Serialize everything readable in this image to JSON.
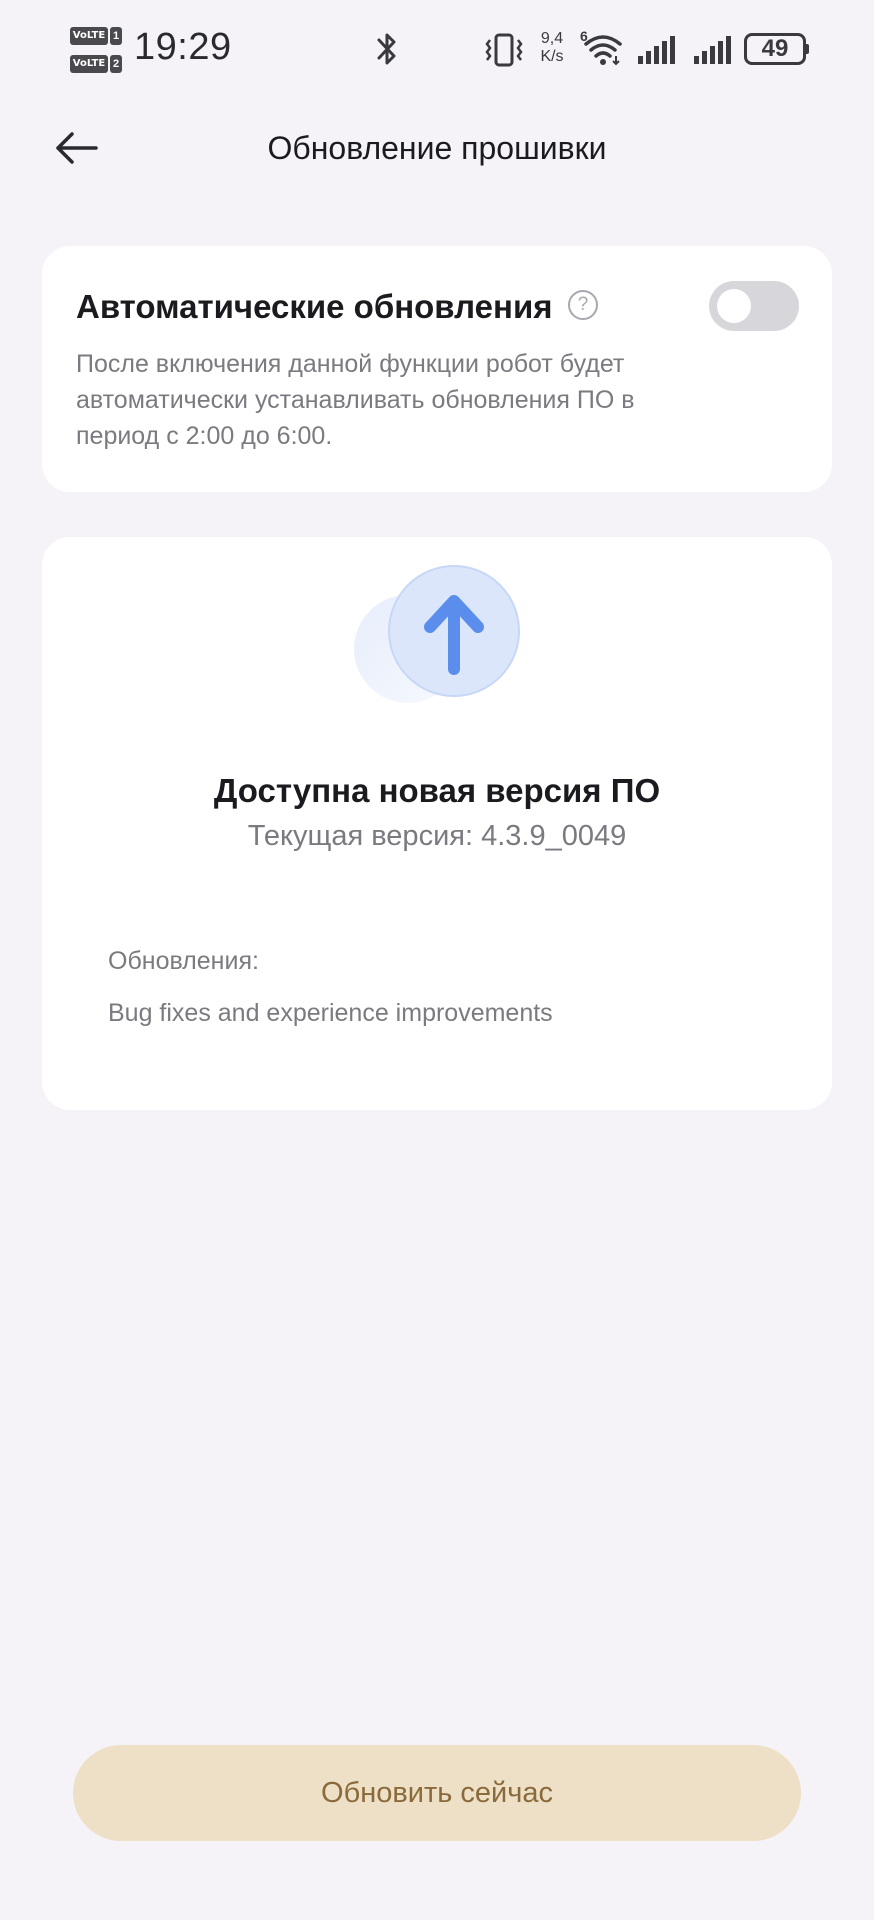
{
  "status_bar": {
    "volte1_tag": "VoLTE",
    "volte1_num": "1",
    "volte2_tag": "VoLTE",
    "volte2_num": "2",
    "time": "19:29",
    "net_speed_value": "9,4",
    "net_speed_unit": "K/s",
    "wifi_badge": "6",
    "battery": "49",
    "icons": [
      "bluetooth-icon",
      "vibrate-icon",
      "wifi-icon",
      "signal-icon",
      "signal-icon",
      "battery-icon"
    ]
  },
  "header": {
    "title": "Обновление прошивки",
    "back_icon": "arrow-left-icon"
  },
  "auto_updates": {
    "title": "Автоматические обновления",
    "help_symbol": "?",
    "description": "После включения данной функции робот будет автоматически устанавливать обновления ПО в период с 2:00 до 6:00.",
    "toggle_on": false
  },
  "update_card": {
    "icon": "arrow-up-icon",
    "title": "Доступна новая версия ПО",
    "current_version": "Текущая версия: 4.3.9_0049",
    "notes_label": "Обновления:",
    "notes_text": "Bug fixes and experience improvements"
  },
  "actions": {
    "update_now": "Обновить сейчас"
  },
  "colors": {
    "background": "#f5f3f7",
    "card": "#ffffff",
    "accent_blue": "#5b8ded",
    "button_bg": "#ede0c6",
    "button_text": "#8a6a3a",
    "toggle_off": "#d7d6db"
  }
}
